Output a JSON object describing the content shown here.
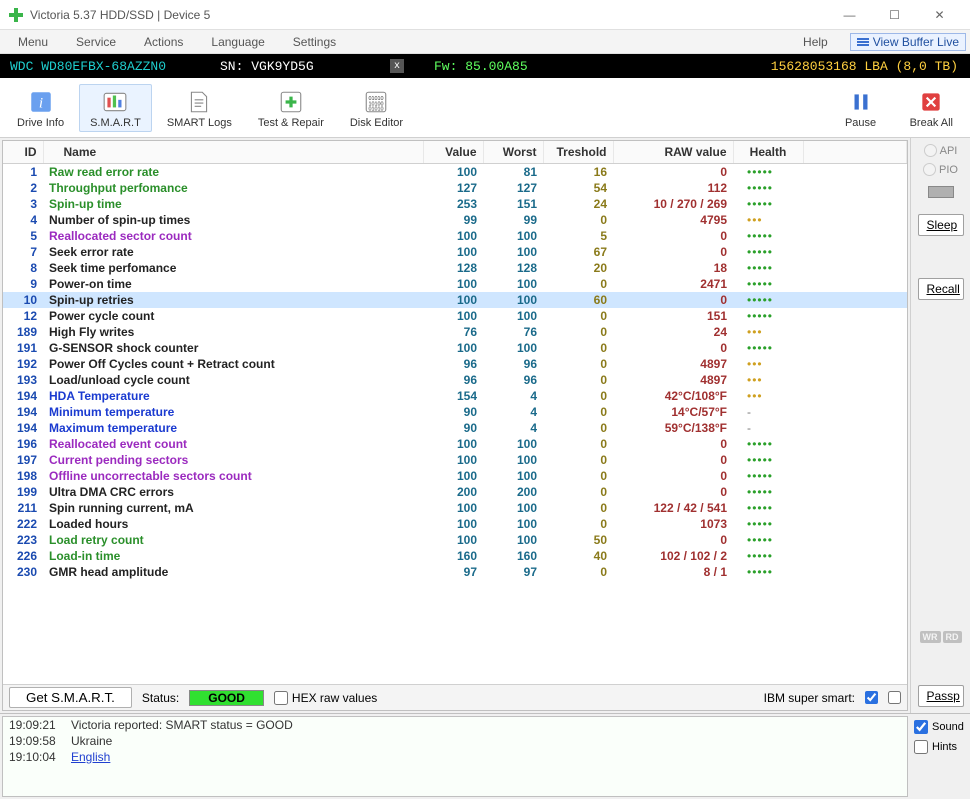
{
  "title": "Victoria 5.37 HDD/SSD | Device 5",
  "menus": [
    "Menu",
    "Service",
    "Actions",
    "Language",
    "Settings"
  ],
  "menu_right": {
    "help": "Help",
    "vbl": "View Buffer Live"
  },
  "info": {
    "model": "WDC WD80EFBX-68AZZN0",
    "sn_label": "SN:",
    "sn": "VGK9YD5G",
    "fw_label": "Fw:",
    "fw": "85.00A85",
    "lba": "15628053168 LBA (8,0 TB)"
  },
  "tools": {
    "drive": "Drive Info",
    "smart": "S.M.A.R.T",
    "logs": "SMART Logs",
    "test": "Test & Repair",
    "disk": "Disk Editor",
    "pause": "Pause",
    "break": "Break All"
  },
  "cols": {
    "id": "ID",
    "name": "Name",
    "value": "Value",
    "worst": "Worst",
    "thr": "Treshold",
    "raw": "RAW value",
    "health": "Health"
  },
  "rows": [
    {
      "id": 1,
      "name": "Raw read error rate",
      "cls": "g",
      "val": 100,
      "worst": 81,
      "thr": 16,
      "raw": "0",
      "h": "good"
    },
    {
      "id": 2,
      "name": "Throughput perfomance",
      "cls": "g",
      "val": 127,
      "worst": 127,
      "thr": 54,
      "raw": "112",
      "h": "good"
    },
    {
      "id": 3,
      "name": "Spin-up time",
      "cls": "g",
      "val": 253,
      "worst": 151,
      "thr": 24,
      "raw": "10 / 270 / 269",
      "h": "good"
    },
    {
      "id": 4,
      "name": "Number of spin-up times",
      "cls": "k",
      "val": 99,
      "worst": 99,
      "thr": 0,
      "raw": "4795",
      "h": "warn"
    },
    {
      "id": 5,
      "name": "Reallocated sector count",
      "cls": "p",
      "val": 100,
      "worst": 100,
      "thr": 5,
      "raw": "0",
      "h": "good"
    },
    {
      "id": 7,
      "name": "Seek error rate",
      "cls": "k",
      "val": 100,
      "worst": 100,
      "thr": 67,
      "raw": "0",
      "h": "good"
    },
    {
      "id": 8,
      "name": "Seek time perfomance",
      "cls": "k",
      "val": 128,
      "worst": 128,
      "thr": 20,
      "raw": "18",
      "h": "good"
    },
    {
      "id": 9,
      "name": "Power-on time",
      "cls": "k",
      "val": 100,
      "worst": 100,
      "thr": 0,
      "raw": "2471",
      "h": "good"
    },
    {
      "id": 10,
      "name": "Spin-up retries",
      "cls": "k",
      "val": 100,
      "worst": 100,
      "thr": 60,
      "raw": "0",
      "h": "good",
      "sel": true
    },
    {
      "id": 12,
      "name": "Power cycle count",
      "cls": "k",
      "val": 100,
      "worst": 100,
      "thr": 0,
      "raw": "151",
      "h": "good"
    },
    {
      "id": 189,
      "name": "High Fly writes",
      "cls": "k",
      "val": 76,
      "worst": 76,
      "thr": 0,
      "raw": "24",
      "h": "warn"
    },
    {
      "id": 191,
      "name": "G-SENSOR shock counter",
      "cls": "k",
      "val": 100,
      "worst": 100,
      "thr": 0,
      "raw": "0",
      "h": "good"
    },
    {
      "id": 192,
      "name": "Power Off Cycles count + Retract count",
      "cls": "k",
      "val": 96,
      "worst": 96,
      "thr": 0,
      "raw": "4897",
      "h": "warn"
    },
    {
      "id": 193,
      "name": "Load/unload cycle count",
      "cls": "k",
      "val": 96,
      "worst": 96,
      "thr": 0,
      "raw": "4897",
      "h": "warn"
    },
    {
      "id": 194,
      "name": "HDA Temperature",
      "cls": "b",
      "val": 154,
      "worst": 4,
      "thr": 0,
      "raw": "42°C/108°F",
      "h": "warn"
    },
    {
      "id": 194,
      "name": "Minimum temperature",
      "cls": "b",
      "val": 90,
      "worst": 4,
      "thr": 0,
      "raw": "14°C/57°F",
      "h": "none"
    },
    {
      "id": 194,
      "name": "Maximum temperature",
      "cls": "b",
      "val": 90,
      "worst": 4,
      "thr": 0,
      "raw": "59°C/138°F",
      "h": "none"
    },
    {
      "id": 196,
      "name": "Reallocated event count",
      "cls": "p",
      "val": 100,
      "worst": 100,
      "thr": 0,
      "raw": "0",
      "h": "good"
    },
    {
      "id": 197,
      "name": "Current pending sectors",
      "cls": "p",
      "val": 100,
      "worst": 100,
      "thr": 0,
      "raw": "0",
      "h": "good"
    },
    {
      "id": 198,
      "name": "Offline uncorrectable sectors count",
      "cls": "p",
      "val": 100,
      "worst": 100,
      "thr": 0,
      "raw": "0",
      "h": "good"
    },
    {
      "id": 199,
      "name": "Ultra DMA CRC errors",
      "cls": "k",
      "val": 200,
      "worst": 200,
      "thr": 0,
      "raw": "0",
      "h": "good"
    },
    {
      "id": 211,
      "name": "Spin running current, mA",
      "cls": "k",
      "val": 100,
      "worst": 100,
      "thr": 0,
      "raw": "122 / 42 / 541",
      "h": "good"
    },
    {
      "id": 222,
      "name": "Loaded hours",
      "cls": "k",
      "val": 100,
      "worst": 100,
      "thr": 0,
      "raw": "1073",
      "h": "good"
    },
    {
      "id": 223,
      "name": "Load retry count",
      "cls": "g",
      "val": 100,
      "worst": 100,
      "thr": 50,
      "raw": "0",
      "h": "good"
    },
    {
      "id": 226,
      "name": "Load-in time",
      "cls": "g",
      "val": 160,
      "worst": 160,
      "thr": 40,
      "raw": "102 / 102 / 2",
      "h": "good"
    },
    {
      "id": 230,
      "name": "GMR head amplitude",
      "cls": "k",
      "val": 97,
      "worst": 97,
      "thr": 0,
      "raw": "8 / 1",
      "h": "good"
    }
  ],
  "bottom": {
    "get": "Get S.M.A.R.T.",
    "status_label": "Status:",
    "status": "GOOD",
    "hex": "HEX raw values",
    "ibm": "IBM super smart:"
  },
  "right": {
    "api": "API",
    "pio": "PIO",
    "sleep": "Sleep",
    "recall": "Recall",
    "passp": "Passp",
    "wr": "WR",
    "rd": "RD"
  },
  "logs": [
    {
      "t": "19:09:21",
      "m": "Victoria reported: SMART status = GOOD",
      "c": ""
    },
    {
      "t": "19:09:58",
      "m": "Ukraine",
      "c": ""
    },
    {
      "t": "19:10:04",
      "m": "English",
      "c": "blue"
    }
  ],
  "logright": {
    "sound": "Sound",
    "hints": "Hints"
  }
}
